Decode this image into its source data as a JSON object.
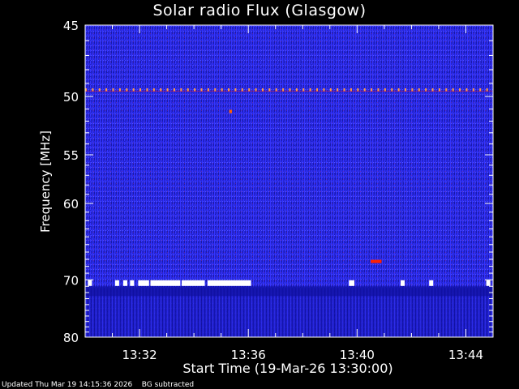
{
  "chart_data": {
    "type": "heatmap",
    "title": "Solar radio Flux (Glasgow)",
    "xlabel": "Start Time (19-Mar-26 13:30:00)",
    "ylabel": "Frequency [MHz]",
    "x_ticks": [
      "13:32",
      "13:36",
      "13:40",
      "13:44"
    ],
    "x_tick_minutes": [
      2,
      6,
      10,
      14
    ],
    "xlim_minutes": [
      0,
      15
    ],
    "y_ticks": [
      45,
      50,
      55,
      60,
      70,
      80
    ],
    "ylim": [
      45,
      80
    ],
    "y_scale": "reciprocal",
    "colormap": [
      "#000080",
      "#2020d0",
      "#3a3aff",
      "#c02060",
      "#ff3000",
      "#ffffff"
    ],
    "features": [
      {
        "name": "interference_line",
        "freq": 49.5,
        "from_min": 0,
        "to_min": 15,
        "color": "#ff9a40"
      },
      {
        "name": "saturation_band",
        "freq": 70.5,
        "segments_min": [
          [
            0.1,
            0.25
          ],
          [
            1.1,
            1.25
          ],
          [
            1.4,
            1.55
          ],
          [
            1.65,
            1.8
          ],
          [
            1.95,
            2.35
          ],
          [
            2.4,
            3.5
          ],
          [
            3.55,
            4.4
          ],
          [
            4.5,
            6.1
          ],
          [
            9.7,
            9.9
          ],
          [
            11.6,
            11.75
          ],
          [
            12.65,
            12.8
          ],
          [
            14.75,
            14.9
          ]
        ],
        "color": "#ffffff"
      },
      {
        "name": "hot_spot",
        "freq": 67.3,
        "from_min": 10.5,
        "to_min": 10.9,
        "color": "#ff2000"
      },
      {
        "name": "hot_spot_small",
        "freq": 51.2,
        "from_min": 5.3,
        "to_min": 5.4,
        "color": "#ff6000"
      }
    ]
  },
  "footer": "Updated Thu Mar 19 14:15:36 2026    BG subtracted"
}
